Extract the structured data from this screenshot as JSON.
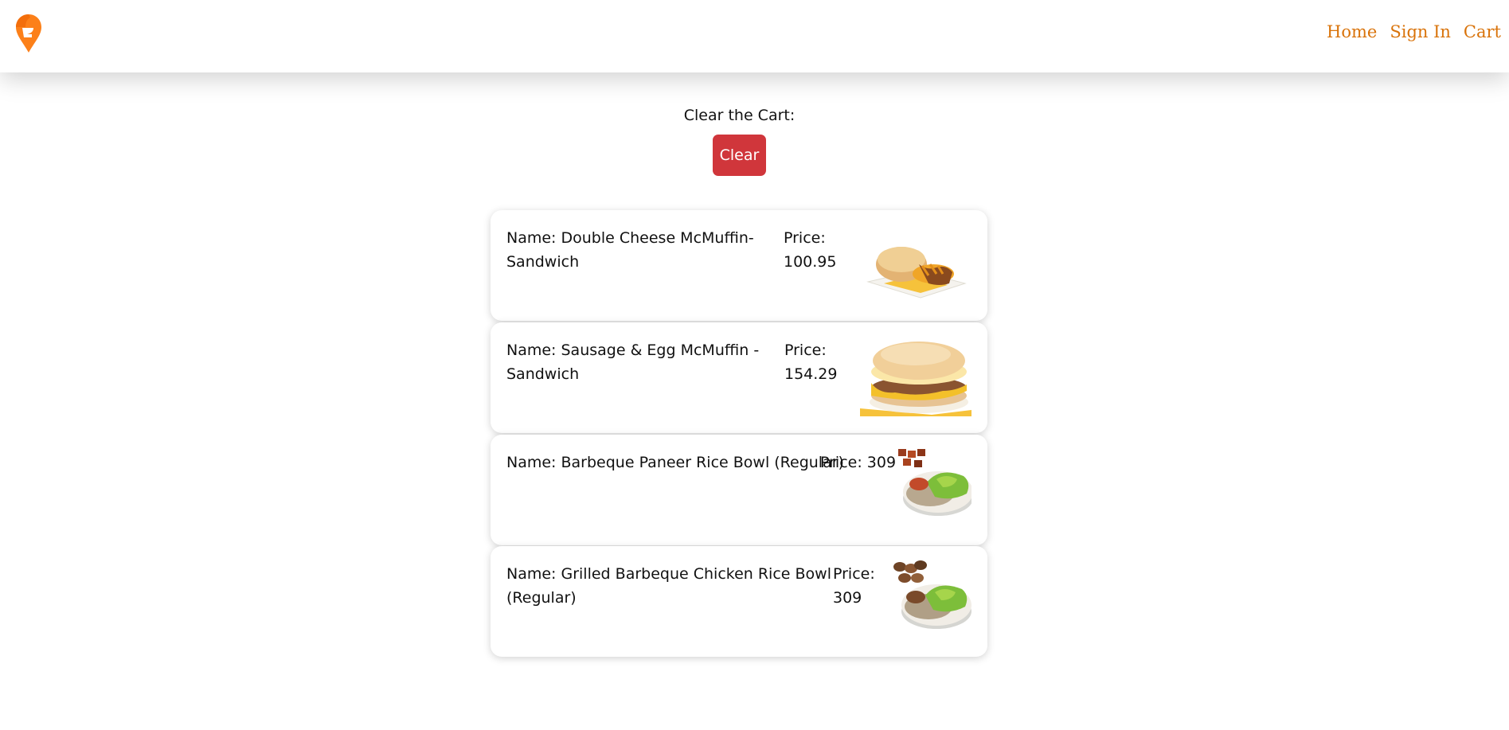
{
  "header": {
    "logo_icon": "swiggy-logo-icon",
    "nav": [
      "Home",
      "Sign In",
      "Cart"
    ]
  },
  "clear": {
    "label": "Clear the Cart:",
    "button_label": "Clear",
    "button_color": "#d0363b"
  },
  "cart_items": [
    {
      "name": "Name: Double Cheese McMuffin-",
      "name2": "Sandwich",
      "price_label": "Price:",
      "price": "100.95",
      "image": "mcmuffin-image"
    },
    {
      "name": "Name: Sausage & Egg McMuffin -",
      "name2": "Sandwich",
      "price_label": "Price:",
      "price": "154.29",
      "image": "sausage-mcmuffin-image"
    },
    {
      "name": "Name: Barbeque Paneer Rice Bowl (Regular)",
      "name2": "",
      "price_label": "Price: 309",
      "price": "",
      "image": "paneer-rice-bowl-image"
    },
    {
      "name": "Name: Grilled Barbeque Chicken Rice Bowl",
      "name2": "(Regular)",
      "price_label": "Price:",
      "price": "309",
      "image": "chicken-rice-bowl-image"
    }
  ],
  "colors": {
    "accent": "#d9730a"
  }
}
